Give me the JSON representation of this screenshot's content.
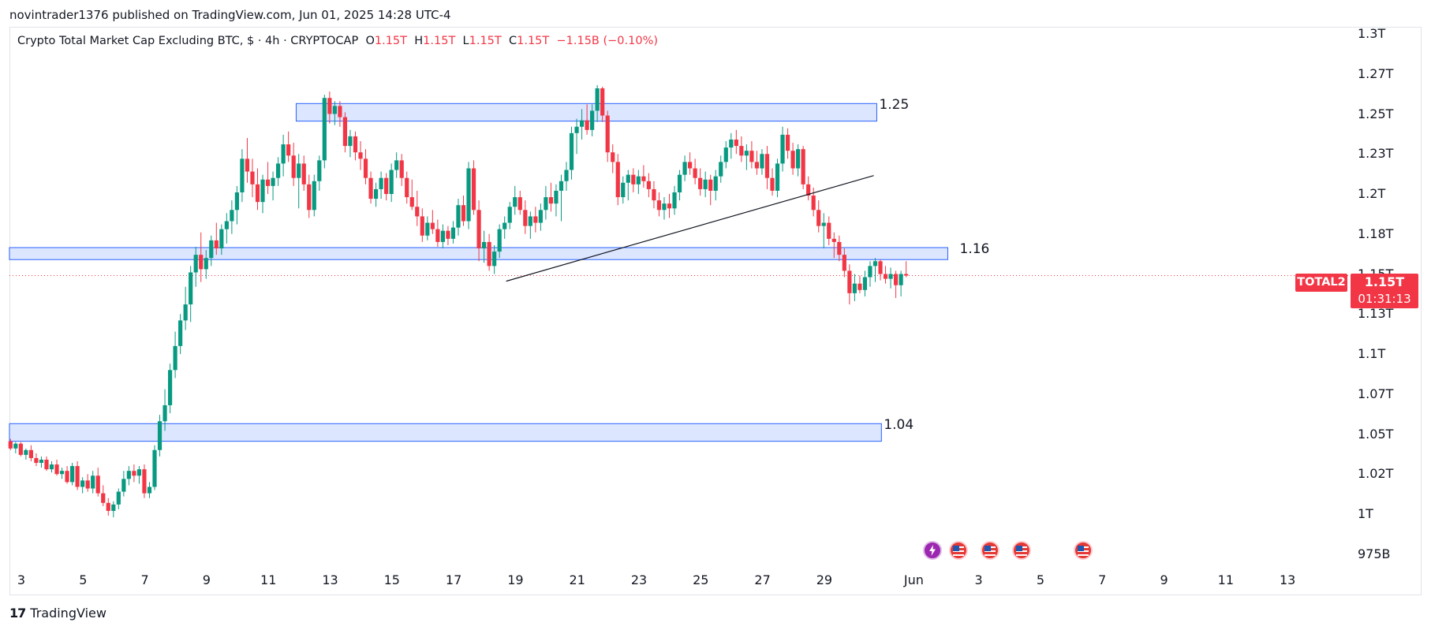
{
  "publish_line": "novintrader1376 published on TradingView.com, Jun 01, 2025 14:28 UTC-4",
  "legend": {
    "title": "Crypto Total Market Cap Excluding BTC, $ · 4h · CRYPTOCAP",
    "o_label": "O",
    "o_value": "1.15T",
    "h_label": "H",
    "h_value": "1.15T",
    "l_label": "L",
    "l_value": "1.15T",
    "c_label": "C",
    "c_value": "1.15T",
    "change": "−1.15B (−0.10%)"
  },
  "symbol_badge": "TOTAL2",
  "price_badge": {
    "price": "1.15T",
    "countdown": "01:31:13"
  },
  "footer_brand": "TradingView",
  "colors": {
    "up": "#089981",
    "down": "#f23645",
    "zone_fill": "#d6e2ff",
    "zone_border": "#2962ff",
    "last_price": "#f23645"
  },
  "chart_data": {
    "type": "candlestick",
    "symbol": "TOTAL2",
    "title": "Crypto Total Market Cap Excluding BTC, $ · 4h · CRYPTOCAP",
    "interval": "4h",
    "y_ticks": [
      "1.3T",
      "1.27T",
      "1.25T",
      "1.23T",
      "1.2T",
      "1.18T",
      "1.15T",
      "1.13T",
      "1.1T",
      "1.07T",
      "1.05T",
      "1.02T",
      "1T",
      "975B"
    ],
    "y_tick_values": [
      1.3,
      1.275,
      1.25,
      1.225,
      1.2,
      1.175,
      1.15,
      1.125,
      1.1,
      1.075,
      1.05,
      1.025,
      1.0,
      0.975
    ],
    "x_ticks": [
      {
        "label": "3",
        "day": 3
      },
      {
        "label": "5",
        "day": 5
      },
      {
        "label": "7",
        "day": 7
      },
      {
        "label": "9",
        "day": 9
      },
      {
        "label": "11",
        "day": 11
      },
      {
        "label": "13",
        "day": 13
      },
      {
        "label": "15",
        "day": 15
      },
      {
        "label": "17",
        "day": 17
      },
      {
        "label": "19",
        "day": 19
      },
      {
        "label": "21",
        "day": 21
      },
      {
        "label": "23",
        "day": 23
      },
      {
        "label": "25",
        "day": 25
      },
      {
        "label": "27",
        "day": 27
      },
      {
        "label": "29",
        "day": 29
      },
      {
        "label": "Jun",
        "day": 32
      },
      {
        "label": "3",
        "day": 34
      },
      {
        "label": "5",
        "day": 36
      },
      {
        "label": "7",
        "day": 38
      },
      {
        "label": "9",
        "day": 40
      },
      {
        "label": "11",
        "day": 42
      },
      {
        "label": "13",
        "day": 44
      }
    ],
    "zones": [
      {
        "label": "1.25",
        "day_start": 11.9,
        "day_end": 30.7,
        "low": 1.2455,
        "high": 1.2565
      },
      {
        "label": "1.16",
        "day_start": 2.6,
        "day_end": 33.0,
        "low": 1.159,
        "high": 1.1665
      },
      {
        "label": "1.04",
        "day_start": 2.6,
        "day_end": 30.85,
        "low": 1.0455,
        "high": 1.0565
      }
    ],
    "trendline": {
      "from": {
        "day": 18.7,
        "value": 1.1455
      },
      "to": {
        "day": 30.6,
        "value": 1.2115
      }
    },
    "last_price": 1.15,
    "candles": [
      [
        1.0455,
        1.047,
        1.04,
        1.041
      ],
      [
        1.041,
        1.045,
        1.038,
        1.044
      ],
      [
        1.044,
        1.045,
        1.036,
        1.037
      ],
      [
        1.037,
        1.041,
        1.034,
        1.04
      ],
      [
        1.04,
        1.043,
        1.033,
        1.035
      ],
      [
        1.035,
        1.038,
        1.03,
        1.032
      ],
      [
        1.032,
        1.036,
        1.029,
        1.034
      ],
      [
        1.034,
        1.036,
        1.027,
        1.028
      ],
      [
        1.028,
        1.033,
        1.026,
        1.031
      ],
      [
        1.031,
        1.034,
        1.024,
        1.025
      ],
      [
        1.025,
        1.029,
        1.022,
        1.027
      ],
      [
        1.027,
        1.03,
        1.019,
        1.02
      ],
      [
        1.02,
        1.032,
        1.018,
        1.03
      ],
      [
        1.03,
        1.033,
        1.015,
        1.017
      ],
      [
        1.017,
        1.023,
        1.013,
        1.021
      ],
      [
        1.021,
        1.025,
        1.014,
        1.016
      ],
      [
        1.016,
        1.027,
        1.013,
        1.024
      ],
      [
        1.024,
        1.029,
        1.011,
        1.013
      ],
      [
        1.013,
        1.018,
        1.005,
        1.007
      ],
      [
        1.007,
        1.01,
        0.999,
        1.002
      ],
      [
        1.002,
        1.008,
        0.998,
        1.006
      ],
      [
        1.006,
        1.016,
        1.003,
        1.014
      ],
      [
        1.014,
        1.027,
        1.011,
        1.022
      ],
      [
        1.022,
        1.03,
        1.018,
        1.027
      ],
      [
        1.027,
        1.031,
        1.02,
        1.024
      ],
      [
        1.024,
        1.03,
        1.019,
        1.028
      ],
      [
        1.028,
        1.031,
        1.01,
        1.013
      ],
      [
        1.013,
        1.02,
        1.01,
        1.017
      ],
      [
        1.017,
        1.043,
        1.015,
        1.04
      ],
      [
        1.04,
        1.062,
        1.036,
        1.058
      ],
      [
        1.058,
        1.078,
        1.052,
        1.068
      ],
      [
        1.068,
        1.094,
        1.063,
        1.09
      ],
      [
        1.09,
        1.114,
        1.085,
        1.105
      ],
      [
        1.105,
        1.125,
        1.1,
        1.121
      ],
      [
        1.121,
        1.142,
        1.115,
        1.131
      ],
      [
        1.131,
        1.155,
        1.12,
        1.151
      ],
      [
        1.151,
        1.167,
        1.142,
        1.162
      ],
      [
        1.162,
        1.176,
        1.145,
        1.153
      ],
      [
        1.153,
        1.165,
        1.147,
        1.16
      ],
      [
        1.16,
        1.174,
        1.155,
        1.171
      ],
      [
        1.171,
        1.182,
        1.162,
        1.166
      ],
      [
        1.166,
        1.181,
        1.162,
        1.178
      ],
      [
        1.178,
        1.188,
        1.169,
        1.183
      ],
      [
        1.183,
        1.196,
        1.175,
        1.19
      ],
      [
        1.19,
        1.205,
        1.181,
        1.201
      ],
      [
        1.201,
        1.228,
        1.195,
        1.222
      ],
      [
        1.222,
        1.235,
        1.207,
        1.214
      ],
      [
        1.214,
        1.222,
        1.198,
        1.206
      ],
      [
        1.206,
        1.216,
        1.19,
        1.195
      ],
      [
        1.195,
        1.212,
        1.188,
        1.209
      ],
      [
        1.209,
        1.22,
        1.2,
        1.205
      ],
      [
        1.205,
        1.214,
        1.196,
        1.21
      ],
      [
        1.21,
        1.223,
        1.205,
        1.219
      ],
      [
        1.219,
        1.237,
        1.211,
        1.231
      ],
      [
        1.231,
        1.239,
        1.22,
        1.224
      ],
      [
        1.224,
        1.232,
        1.205,
        1.21
      ],
      [
        1.21,
        1.225,
        1.191,
        1.219
      ],
      [
        1.219,
        1.224,
        1.202,
        1.206
      ],
      [
        1.206,
        1.212,
        1.185,
        1.19
      ],
      [
        1.19,
        1.212,
        1.186,
        1.208
      ],
      [
        1.208,
        1.224,
        1.202,
        1.221
      ],
      [
        1.221,
        1.262,
        1.216,
        1.26
      ],
      [
        1.26,
        1.264,
        1.244,
        1.25
      ],
      [
        1.25,
        1.258,
        1.243,
        1.255
      ],
      [
        1.255,
        1.258,
        1.242,
        1.248
      ],
      [
        1.248,
        1.251,
        1.226,
        1.23
      ],
      [
        1.23,
        1.24,
        1.223,
        1.236
      ],
      [
        1.236,
        1.239,
        1.221,
        1.226
      ],
      [
        1.226,
        1.233,
        1.215,
        1.222
      ],
      [
        1.222,
        1.228,
        1.206,
        1.21
      ],
      [
        1.21,
        1.214,
        1.194,
        1.197
      ],
      [
        1.197,
        1.207,
        1.192,
        1.203
      ],
      [
        1.203,
        1.214,
        1.197,
        1.21
      ],
      [
        1.21,
        1.213,
        1.196,
        1.2
      ],
      [
        1.2,
        1.219,
        1.195,
        1.215
      ],
      [
        1.215,
        1.226,
        1.21,
        1.221
      ],
      [
        1.221,
        1.225,
        1.205,
        1.21
      ],
      [
        1.21,
        1.214,
        1.194,
        1.198
      ],
      [
        1.198,
        1.209,
        1.19,
        1.192
      ],
      [
        1.192,
        1.202,
        1.18,
        1.186
      ],
      [
        1.186,
        1.191,
        1.17,
        1.174
      ],
      [
        1.174,
        1.186,
        1.171,
        1.182
      ],
      [
        1.182,
        1.19,
        1.175,
        1.178
      ],
      [
        1.178,
        1.184,
        1.167,
        1.17
      ],
      [
        1.17,
        1.181,
        1.166,
        1.177
      ],
      [
        1.177,
        1.18,
        1.168,
        1.172
      ],
      [
        1.172,
        1.183,
        1.169,
        1.179
      ],
      [
        1.179,
        1.197,
        1.174,
        1.193
      ],
      [
        1.193,
        1.199,
        1.18,
        1.183
      ],
      [
        1.183,
        1.22,
        1.178,
        1.216
      ],
      [
        1.216,
        1.221,
        1.187,
        1.19
      ],
      [
        1.19,
        1.196,
        1.158,
        1.166
      ],
      [
        1.166,
        1.177,
        1.157,
        1.17
      ],
      [
        1.17,
        1.175,
        1.152,
        1.155
      ],
      [
        1.155,
        1.168,
        1.15,
        1.164
      ],
      [
        1.164,
        1.181,
        1.16,
        1.178
      ],
      [
        1.178,
        1.186,
        1.172,
        1.182
      ],
      [
        1.182,
        1.195,
        1.178,
        1.192
      ],
      [
        1.192,
        1.205,
        1.187,
        1.198
      ],
      [
        1.198,
        1.202,
        1.187,
        1.19
      ],
      [
        1.19,
        1.196,
        1.175,
        1.18
      ],
      [
        1.18,
        1.189,
        1.172,
        1.186
      ],
      [
        1.186,
        1.192,
        1.176,
        1.182
      ],
      [
        1.182,
        1.194,
        1.177,
        1.19
      ],
      [
        1.19,
        1.205,
        1.184,
        1.198
      ],
      [
        1.198,
        1.207,
        1.189,
        1.194
      ],
      [
        1.194,
        1.206,
        1.186,
        1.202
      ],
      [
        1.202,
        1.212,
        1.183,
        1.208
      ],
      [
        1.208,
        1.22,
        1.202,
        1.215
      ],
      [
        1.215,
        1.242,
        1.209,
        1.238
      ],
      [
        1.238,
        1.247,
        1.225,
        1.242
      ],
      [
        1.242,
        1.253,
        1.234,
        1.246
      ],
      [
        1.246,
        1.256,
        1.237,
        1.24
      ],
      [
        1.24,
        1.256,
        1.236,
        1.252
      ],
      [
        1.252,
        1.268,
        1.245,
        1.266
      ],
      [
        1.266,
        1.267,
        1.245,
        1.249
      ],
      [
        1.249,
        1.252,
        1.22,
        1.226
      ],
      [
        1.226,
        1.231,
        1.213,
        1.22
      ],
      [
        1.22,
        1.225,
        1.193,
        1.198
      ],
      [
        1.198,
        1.211,
        1.194,
        1.207
      ],
      [
        1.207,
        1.215,
        1.196,
        1.212
      ],
      [
        1.212,
        1.216,
        1.201,
        1.206
      ],
      [
        1.206,
        1.215,
        1.2,
        1.211
      ],
      [
        1.211,
        1.218,
        1.204,
        1.208
      ],
      [
        1.208,
        1.213,
        1.198,
        1.203
      ],
      [
        1.203,
        1.208,
        1.191,
        1.196
      ],
      [
        1.196,
        1.201,
        1.186,
        1.19
      ],
      [
        1.19,
        1.198,
        1.184,
        1.194
      ],
      [
        1.194,
        1.2,
        1.185,
        1.191
      ],
      [
        1.191,
        1.205,
        1.187,
        1.201
      ],
      [
        1.201,
        1.215,
        1.196,
        1.212
      ],
      [
        1.212,
        1.224,
        1.208,
        1.22
      ],
      [
        1.22,
        1.226,
        1.212,
        1.216
      ],
      [
        1.216,
        1.222,
        1.206,
        1.21
      ],
      [
        1.21,
        1.216,
        1.199,
        1.203
      ],
      [
        1.203,
        1.214,
        1.198,
        1.209
      ],
      [
        1.209,
        1.212,
        1.193,
        1.202
      ],
      [
        1.202,
        1.215,
        1.196,
        1.211
      ],
      [
        1.211,
        1.224,
        1.207,
        1.22
      ],
      [
        1.22,
        1.233,
        1.216,
        1.229
      ],
      [
        1.229,
        1.238,
        1.222,
        1.234
      ],
      [
        1.234,
        1.24,
        1.225,
        1.23
      ],
      [
        1.23,
        1.236,
        1.22,
        1.224
      ],
      [
        1.224,
        1.231,
        1.215,
        1.227
      ],
      [
        1.227,
        1.233,
        1.216,
        1.22
      ],
      [
        1.22,
        1.227,
        1.212,
        1.216
      ],
      [
        1.216,
        1.228,
        1.212,
        1.225
      ],
      [
        1.225,
        1.23,
        1.203,
        1.21
      ],
      [
        1.21,
        1.216,
        1.199,
        1.202
      ],
      [
        1.202,
        1.222,
        1.198,
        1.219
      ],
      [
        1.219,
        1.242,
        1.214,
        1.237
      ],
      [
        1.237,
        1.241,
        1.222,
        1.227
      ],
      [
        1.227,
        1.232,
        1.212,
        1.216
      ],
      [
        1.216,
        1.231,
        1.211,
        1.228
      ],
      [
        1.228,
        1.23,
        1.203,
        1.206
      ],
      [
        1.206,
        1.211,
        1.196,
        1.199
      ],
      [
        1.199,
        1.204,
        1.186,
        1.19
      ],
      [
        1.19,
        1.196,
        1.176,
        1.18
      ],
      [
        1.18,
        1.188,
        1.166,
        1.182
      ],
      [
        1.182,
        1.186,
        1.168,
        1.172
      ],
      [
        1.172,
        1.176,
        1.16,
        1.17
      ],
      [
        1.17,
        1.174,
        1.158,
        1.162
      ],
      [
        1.162,
        1.166,
        1.148,
        1.152
      ],
      [
        1.152,
        1.156,
        1.131,
        1.138
      ],
      [
        1.138,
        1.15,
        1.133,
        1.144
      ],
      [
        1.144,
        1.149,
        1.138,
        1.14
      ],
      [
        1.14,
        1.152,
        1.136,
        1.148
      ],
      [
        1.148,
        1.158,
        1.142,
        1.155
      ],
      [
        1.155,
        1.16,
        1.145,
        1.158
      ],
      [
        1.158,
        1.159,
        1.146,
        1.15
      ],
      [
        1.15,
        1.155,
        1.144,
        1.147
      ],
      [
        1.147,
        1.154,
        1.141,
        1.15
      ],
      [
        1.15,
        1.152,
        1.135,
        1.143
      ],
      [
        1.143,
        1.152,
        1.136,
        1.15
      ],
      [
        1.15,
        1.158,
        1.148,
        1.149
      ]
    ]
  }
}
